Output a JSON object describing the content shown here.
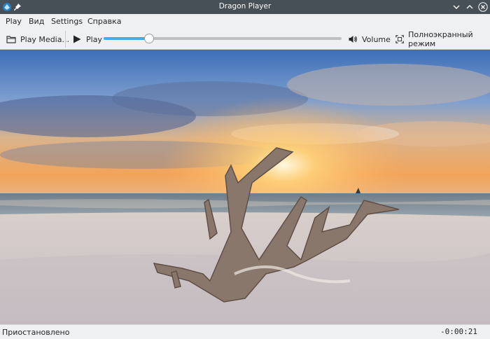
{
  "window": {
    "title": "Dragon Player",
    "controls": [
      "chevron-down-icon",
      "chevron-up-icon",
      "close-icon"
    ]
  },
  "menubar": {
    "items": [
      {
        "label": "Play"
      },
      {
        "label": "Вид"
      },
      {
        "label": "Settings"
      },
      {
        "label": "Справка"
      }
    ]
  },
  "toolbar": {
    "play_media_label": "Play Media...",
    "play_label": "Play",
    "volume_label": "Volume",
    "fullscreen_label": "Полноэкранный режим",
    "seek_fraction": 0.19
  },
  "video": {
    "description_icon": "video-frame"
  },
  "status": {
    "text": "Приостановлено",
    "time": "-0:00:21"
  },
  "colors": {
    "accent": "#3daee9",
    "titlebar": "#475057",
    "window_bg": "#eff0f1"
  }
}
